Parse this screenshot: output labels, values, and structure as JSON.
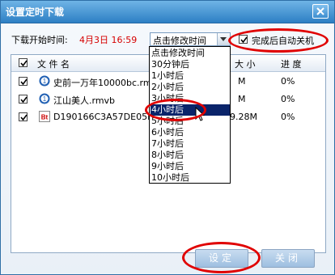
{
  "window": {
    "title": "设置定时下载"
  },
  "start": {
    "label": "下载开始时间:",
    "value": "4月3日 16:59"
  },
  "combo": {
    "value": "点击修改时间"
  },
  "auto_shutdown": {
    "label": "完成后自动关机",
    "checked": true
  },
  "table": {
    "headers": [
      "文 件 名",
      "大 小",
      "进 度"
    ],
    "rows": [
      {
        "name": "史前一万年10000bc.rm",
        "icon": "rm-file-icon",
        "size": "M",
        "progress": "0%"
      },
      {
        "name": "江山美人.rmvb",
        "icon": "rmvb-file-icon",
        "size": "M",
        "progress": "0%"
      },
      {
        "name": "D190166C3A57DE05E8E",
        "icon": "bt-file-icon",
        "size": "9.28M",
        "progress": "0%"
      }
    ]
  },
  "dropdown": {
    "options": [
      "点击修改时间",
      "30分钟后",
      "1小时后",
      "2小时后",
      "3小时后",
      "4小时后",
      "5小时后",
      "6小时后",
      "7小时后",
      "8小时后",
      "9小时后",
      "10小时后"
    ],
    "selected": "4小时后"
  },
  "buttons": {
    "set": "设定",
    "close": "关闭"
  },
  "colors": {
    "titlebar": "#2d7fc4",
    "highlight": "#0a246a",
    "annotation": "#e00000",
    "time": "#d60000"
  }
}
